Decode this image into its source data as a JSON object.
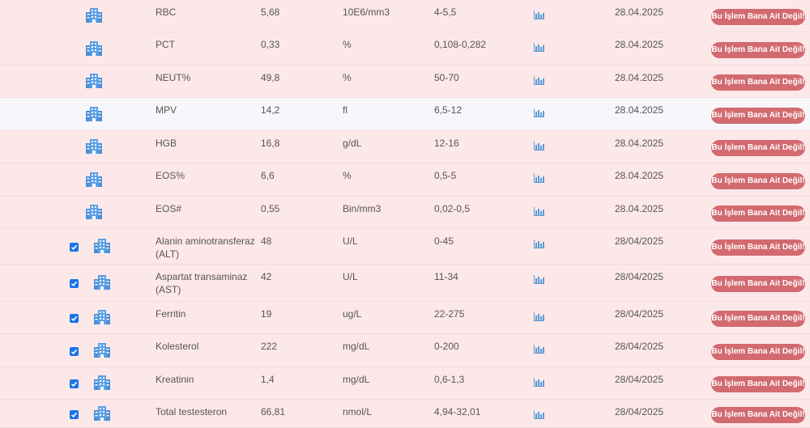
{
  "button_label": "Bu İşlem Bana Ait Değil!",
  "rows": [
    {
      "name": "RBC",
      "value": "5,68",
      "unit": "10E6/mm3",
      "range": "4-5,5",
      "date": "28.04.2025",
      "checked": false
    },
    {
      "name": "PCT",
      "value": "0,33",
      "unit": "%",
      "range": "0,108-0,282",
      "date": "28.04.2025",
      "checked": false
    },
    {
      "name": "NEUT%",
      "value": "49,8",
      "unit": "%",
      "range": "50-70",
      "date": "28.04.2025",
      "checked": false
    },
    {
      "name": "MPV",
      "value": "14,2",
      "unit": "fl",
      "range": "6,5-12",
      "date": "28.04.2025",
      "checked": false
    },
    {
      "name": "HGB",
      "value": "16,8",
      "unit": "g/dL",
      "range": "12-16",
      "date": "28.04.2025",
      "checked": false
    },
    {
      "name": "EOS%",
      "value": "6,6",
      "unit": "%",
      "range": "0,5-5",
      "date": "28.04.2025",
      "checked": false
    },
    {
      "name": "EOS#",
      "value": "0,55",
      "unit": "Bin/mm3",
      "range": "0,02-0,5",
      "date": "28.04.2025",
      "checked": false
    },
    {
      "name": "Alanin aminotransferaz (ALT)",
      "value": "48",
      "unit": "U/L",
      "range": "0-45",
      "date": "28/04/2025",
      "checked": true
    },
    {
      "name": "Aspartat transaminaz (AST)",
      "value": "42",
      "unit": "U/L",
      "range": "11-34",
      "date": "28/04/2025",
      "checked": true
    },
    {
      "name": "Ferritin",
      "value": "19",
      "unit": "ug/L",
      "range": "22-275",
      "date": "28/04/2025",
      "checked": true
    },
    {
      "name": "Kolesterol",
      "value": "222",
      "unit": "mg/dL",
      "range": "0-200",
      "date": "28/04/2025",
      "checked": true
    },
    {
      "name": "Kreatinin",
      "value": "1,4",
      "unit": "mg/dL",
      "range": "0,6-1,3",
      "date": "28/04/2025",
      "checked": true
    },
    {
      "name": "Total testesteron",
      "value": "66,81",
      "unit": "nmol/L",
      "range": "4,94-32,01",
      "date": "28/04/2025",
      "checked": true
    }
  ],
  "colors": {
    "row_pink": "#fde8e9",
    "row_light": "#f7f7fb",
    "button": "#d26a6f",
    "icon_blue": "#4a90d9",
    "checkbox": "#1a73e8"
  }
}
